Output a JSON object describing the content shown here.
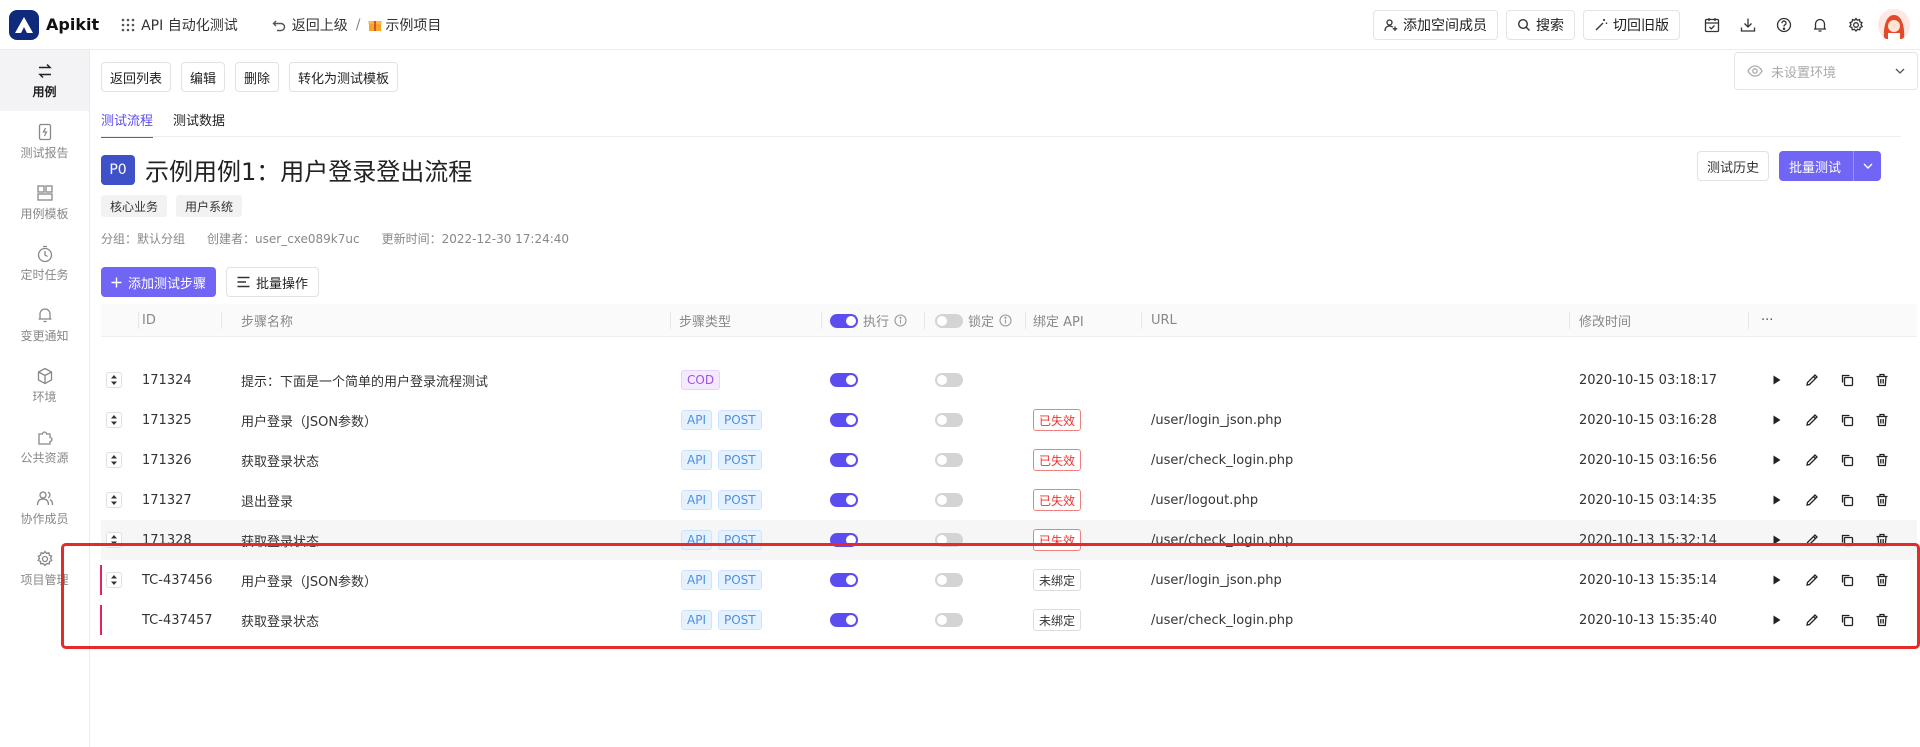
{
  "app": {
    "logo": "Apikit",
    "workspace": "API 自动化测试",
    "back": "返回上级",
    "breadcrumb_sep": "/",
    "project": "示例项目"
  },
  "header_actions": {
    "add_member": "添加空间成员",
    "search": "搜索",
    "old_version": "切回旧版"
  },
  "sidebar": {
    "items": [
      {
        "label": "用例",
        "icon": "swap-arrows-icon",
        "active": true
      },
      {
        "label": "测试报告",
        "icon": "report-icon"
      },
      {
        "label": "用例模板",
        "icon": "template-icon"
      },
      {
        "label": "定时任务",
        "icon": "timer-icon"
      },
      {
        "label": "变更通知",
        "icon": "bell-icon"
      },
      {
        "label": "环境",
        "icon": "cube-icon"
      },
      {
        "label": "公共资源",
        "icon": "puzzle-icon"
      },
      {
        "label": "协作成员",
        "icon": "users-icon"
      },
      {
        "label": "项目管理",
        "icon": "gear-icon"
      }
    ]
  },
  "toolbar": {
    "back_list": "返回列表",
    "edit": "编辑",
    "delete": "删除",
    "to_template": "转化为测试模板",
    "env_placeholder": "未设置环境"
  },
  "tabs": [
    {
      "label": "测试流程",
      "active": true
    },
    {
      "label": "测试数据",
      "active": false
    }
  ],
  "case": {
    "priority": "P0",
    "title": "示例用例1：用户登录登出流程",
    "tags": [
      "核心业务",
      "用户系统"
    ],
    "group": "分组：默认分组",
    "creator": "创建者：user_cxe089k7uc",
    "updated": "更新时间：2022-12-30 17:24:40",
    "history_btn": "测试历史",
    "batch_test_btn": "批量测试"
  },
  "step_actions": {
    "add_step": "添加测试步骤",
    "batch_ops": "批量操作"
  },
  "table": {
    "columns": {
      "id": "ID",
      "name": "步骤名称",
      "type": "步骤类型",
      "exec": "执行",
      "lock": "锁定",
      "bind_api": "绑定 API",
      "url": "URL",
      "mtime": "修改时间",
      "more": "···"
    },
    "rows": [
      {
        "id": "171324",
        "name": "提示：下面是一个简单的用户登录流程测试",
        "types": [
          "COD"
        ],
        "exec": true,
        "lock": false,
        "status": "",
        "url": "",
        "mtime": "2020-10-15 03:18:17",
        "draggable": true,
        "marked": false
      },
      {
        "id": "171325",
        "name": "用户登录（JSON参数）",
        "types": [
          "API",
          "POST"
        ],
        "exec": true,
        "lock": false,
        "status": "已失效",
        "url": "/user/login_json.php",
        "mtime": "2020-10-15 03:16:28",
        "draggable": true,
        "marked": false
      },
      {
        "id": "171326",
        "name": "获取登录状态",
        "types": [
          "API",
          "POST"
        ],
        "exec": true,
        "lock": false,
        "status": "已失效",
        "url": "/user/check_login.php",
        "mtime": "2020-10-15 03:16:56",
        "draggable": true,
        "marked": false
      },
      {
        "id": "171327",
        "name": "退出登录",
        "types": [
          "API",
          "POST"
        ],
        "exec": true,
        "lock": false,
        "status": "已失效",
        "url": "/user/logout.php",
        "mtime": "2020-10-15 03:14:35",
        "draggable": true,
        "marked": false
      },
      {
        "id": "171328",
        "name": "获取登录状态",
        "types": [
          "API",
          "POST"
        ],
        "exec": true,
        "lock": false,
        "status": "已失效",
        "url": "/user/check_login.php",
        "mtime": "2020-10-13 15:32:14",
        "draggable": true,
        "marked": false,
        "gray": true
      },
      {
        "id": "TC-437456",
        "name": "用户登录（JSON参数）",
        "types": [
          "API",
          "POST"
        ],
        "exec": true,
        "lock": false,
        "status": "未绑定",
        "url": "/user/login_json.php",
        "mtime": "2020-10-13 15:35:14",
        "draggable": true,
        "marked": true
      },
      {
        "id": "TC-437457",
        "name": "获取登录状态",
        "types": [
          "API",
          "POST"
        ],
        "exec": true,
        "lock": false,
        "status": "未绑定",
        "url": "/user/check_login.php",
        "mtime": "2020-10-13 15:35:40",
        "draggable": false,
        "marked": true
      }
    ]
  }
}
